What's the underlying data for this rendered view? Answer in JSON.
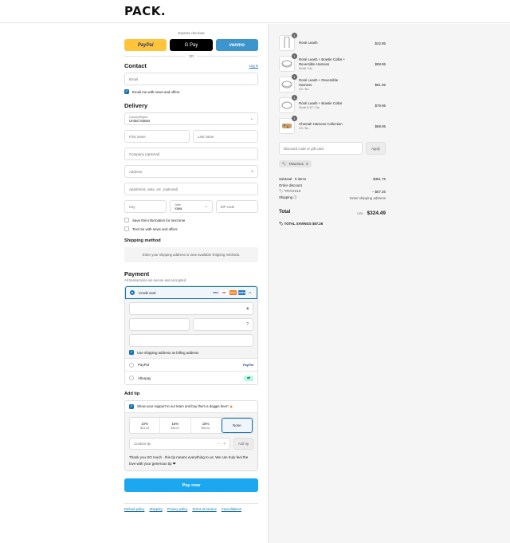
{
  "brand": {
    "logo": "PACK."
  },
  "express": {
    "label": "Express checkout",
    "paypal": "PayPal",
    "gpay": "G Pay",
    "venmo": "venmo",
    "or": "OR"
  },
  "contact": {
    "title": "Contact",
    "login": "Log in",
    "email_placeholder": "Email",
    "news_label": "Email me with news and offers"
  },
  "delivery": {
    "title": "Delivery",
    "country_label": "Country/Region",
    "country_value": "United States",
    "first_name": "First name",
    "last_name": "Last name",
    "company": "Company (optional)",
    "address": "Address",
    "apartment": "Apartment, suite, etc. (optional)",
    "city": "City",
    "state_label": "State",
    "state_value": "Iowa",
    "zip": "ZIP code",
    "save_info": "Save this information for next time",
    "text_me": "Text me with news and offers"
  },
  "shipping": {
    "title": "Shipping method",
    "info": "Enter your shipping address to view available shipping methods."
  },
  "payment": {
    "title": "Payment",
    "subtitle": "All transactions are secure and encrypted.",
    "credit_card": "Credit card",
    "card_brands": [
      "VISA",
      "MC",
      "DISC",
      "AMEX",
      "+5"
    ],
    "billing_same": "Use shipping address as billing address",
    "paypal": "PayPal",
    "paypal_logo": "PayPal",
    "afterpay": "Afterpay"
  },
  "tip": {
    "title": "Add tip",
    "support": "Show your support to our team and buy them a doggie beer! 🍺",
    "options": [
      {
        "pct": "10%",
        "amt": "$23.45"
      },
      {
        "pct": "15%",
        "amt": "$48.67"
      },
      {
        "pct": "18%",
        "amt": "$58.41"
      },
      {
        "pct": "None",
        "amt": ""
      }
    ],
    "custom": "Custom tip",
    "add": "Add tip",
    "thanks": "Thank you SO much - this tip means everything to us. We can truly feel the love with your generous tip ❤"
  },
  "pay_now": "Pay now",
  "footer": [
    "Refund policy",
    "Shipping",
    "Privacy policy",
    "Terms of service",
    "Cancellations"
  ],
  "cart": {
    "items": [
      {
        "name": "Rosé Leash",
        "variant": "",
        "price": "$32.95",
        "qty": "1"
      },
      {
        "name": "Rosé Leash + Bowtie Collar + Reversible Harness",
        "variant": "Small / No",
        "price": "$98.95",
        "qty": "1"
      },
      {
        "name": "Rosé Leash + Reversible Harness",
        "variant": "XS / No",
        "price": "$81.95",
        "qty": "1"
      },
      {
        "name": "Rosé Leash + Bowtie Collar",
        "variant": "Small 8-12\" / No",
        "price": "$79.95",
        "qty": "1"
      },
      {
        "name": "Cheetah Harness Collection",
        "variant": "XS / No",
        "price": "$88.95",
        "qty": "1"
      }
    ],
    "discount_placeholder": "Discount code or gift card",
    "apply": "Apply",
    "code": "TRAVIS15",
    "subtotal_label": "Subtotal · 5 items",
    "subtotal": "$381.75",
    "order_discount": "Order discount",
    "discount_code": "TRAVIS15",
    "discount_value": "– $57.26",
    "shipping_label": "Shipping",
    "shipping_value": "Enter shipping address",
    "total_label": "Total",
    "currency": "USD",
    "total": "$324.49",
    "savings_label": "TOTAL SAVINGS",
    "savings": "$57.26"
  }
}
